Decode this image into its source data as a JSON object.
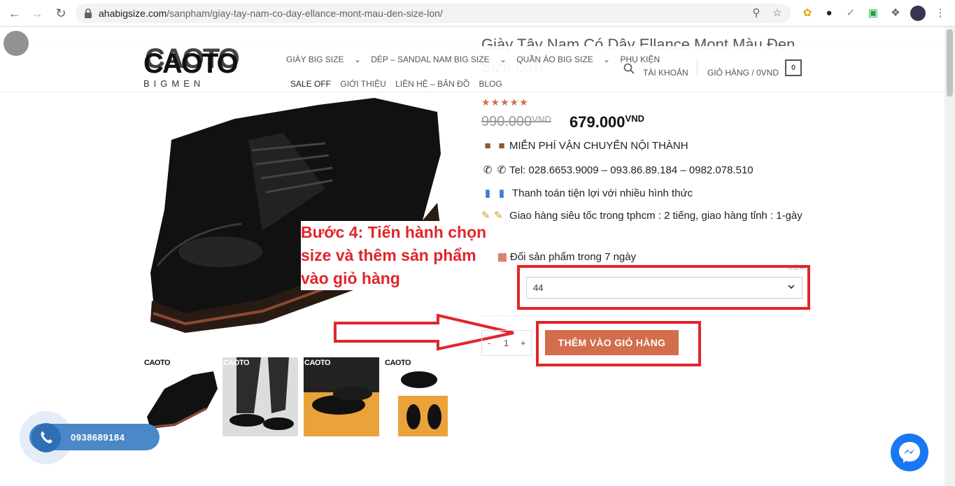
{
  "browser": {
    "url_host": "ahabigsize.com",
    "url_path": "/sanpham/giay-tay-nam-co-day-ellance-mont-mau-den-size-lon/"
  },
  "header": {
    "logo_text": "CAOTO",
    "logo_sub": "BIGMEN",
    "nav_row1": [
      "GIÀY BIG SIZE",
      "DÉP – SANDAL NAM BIG SIZE",
      "QUẦN ÁO BIG SIZE",
      "PHỤ KIỆN"
    ],
    "nav_row2": [
      "SALE OFF",
      "GIỚI THIỆU",
      "LIÊN HỆ – BẢN ĐỒ",
      "BLOG"
    ],
    "account": "TÀI KHOẢN",
    "cart": "GIỎ HÀNG / 0VND",
    "cart_count": "0"
  },
  "product": {
    "title": "Giày Tây Nam Có Dây Ellance Mont Màu Đen Size Lớn",
    "rating_stars": 5,
    "old_price": "990.000",
    "new_price": "679.000",
    "currency": "VND",
    "info": {
      "free_ship": "MIỄN PHÍ VẬN CHUYỂN NỘI THÀNH",
      "tel": "Tel: 028.6653.9009 – 093.86.89.184 – 0982.078.510",
      "payment": "Thanh toán tiện lợi với nhiều hình thức",
      "delivery": "Giao hàng siêu tốc trong tphcm : 2 tiếng, giao hàng tỉnh : 1-gày",
      "exchange": "Đổi sản phẩm trong 7 ngày"
    },
    "clear_label": "XÓA",
    "size_selected": "44",
    "quantity": "1",
    "qty_minus": "-",
    "qty_plus": "+",
    "add_to_cart": "THÊM VÀO GIỎ HÀNG"
  },
  "annotation": {
    "text": "Bước 4: Tiến hành chọn size và thêm sản phẩm vào giỏ hàng",
    "color": "#e0262b"
  },
  "thumbnails": [
    {
      "label": "CAOTO"
    },
    {
      "label": "CAOTO"
    },
    {
      "label": "CAOTO"
    },
    {
      "label": "CAOTO"
    }
  ],
  "contact": {
    "phone": "0938689184"
  },
  "colors": {
    "accent": "#d26e4b",
    "annotation_red": "#e0262b",
    "phone_blue": "#4a88c7",
    "messenger_blue": "#1877f2"
  }
}
